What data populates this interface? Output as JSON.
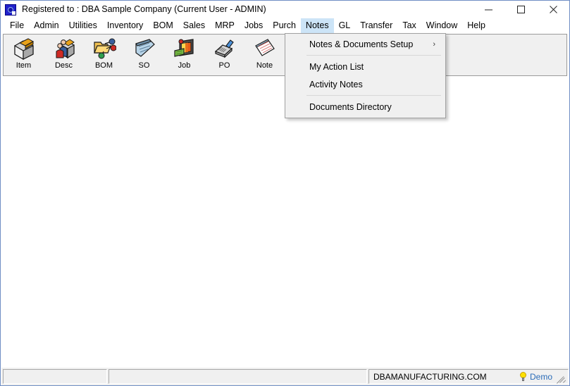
{
  "window": {
    "title": "Registered to : DBA Sample Company (Current User - ADMIN)",
    "app_icon": "application-icon",
    "controls": {
      "minimize_label": "—",
      "maximize_label": "□",
      "close_label": "✕"
    },
    "border_color": "#6f8ec4"
  },
  "menubar": {
    "items": [
      {
        "label": "File",
        "active": false
      },
      {
        "label": "Admin",
        "active": false
      },
      {
        "label": "Utilities",
        "active": false
      },
      {
        "label": "Inventory",
        "active": false
      },
      {
        "label": "BOM",
        "active": false
      },
      {
        "label": "Sales",
        "active": false
      },
      {
        "label": "MRP",
        "active": false
      },
      {
        "label": "Jobs",
        "active": false
      },
      {
        "label": "Purch",
        "active": false
      },
      {
        "label": "Notes",
        "active": true
      },
      {
        "label": "GL",
        "active": false
      },
      {
        "label": "Transfer",
        "active": false
      },
      {
        "label": "Tax",
        "active": false
      },
      {
        "label": "Window",
        "active": false
      },
      {
        "label": "Help",
        "active": false
      }
    ],
    "highlight_color": "#cce4f7"
  },
  "toolbar": {
    "buttons": [
      {
        "label": "Item",
        "icon": "item-box-icon"
      },
      {
        "label": "Desc",
        "icon": "descriptors-people-icon"
      },
      {
        "label": "BOM",
        "icon": "bom-folder-icon"
      },
      {
        "label": "SO",
        "icon": "sales-order-pad-icon"
      },
      {
        "label": "Job",
        "icon": "job-monitor-icon"
      },
      {
        "label": "PO",
        "icon": "purchase-order-stamp-icon"
      },
      {
        "label": "Note",
        "icon": "note-pad-icon"
      }
    ]
  },
  "notes_menu": {
    "open": true,
    "items": [
      {
        "label": "Notes & Documents Setup",
        "has_submenu": true,
        "submenu_arrow": "›"
      },
      {
        "separator": true
      },
      {
        "label": "My Action List",
        "has_submenu": false
      },
      {
        "label": "Activity Notes",
        "has_submenu": false
      },
      {
        "separator": true
      },
      {
        "label": "Documents Directory",
        "has_submenu": false
      }
    ]
  },
  "statusbar": {
    "panel1": "",
    "panel2": "",
    "url": "DBAMANUFACTURING.COM",
    "demo_label": "Demo",
    "demo_color": "#2b6cb8",
    "bulb_icon": "lightbulb-icon",
    "resize_grip": "resize-grip-icon"
  }
}
